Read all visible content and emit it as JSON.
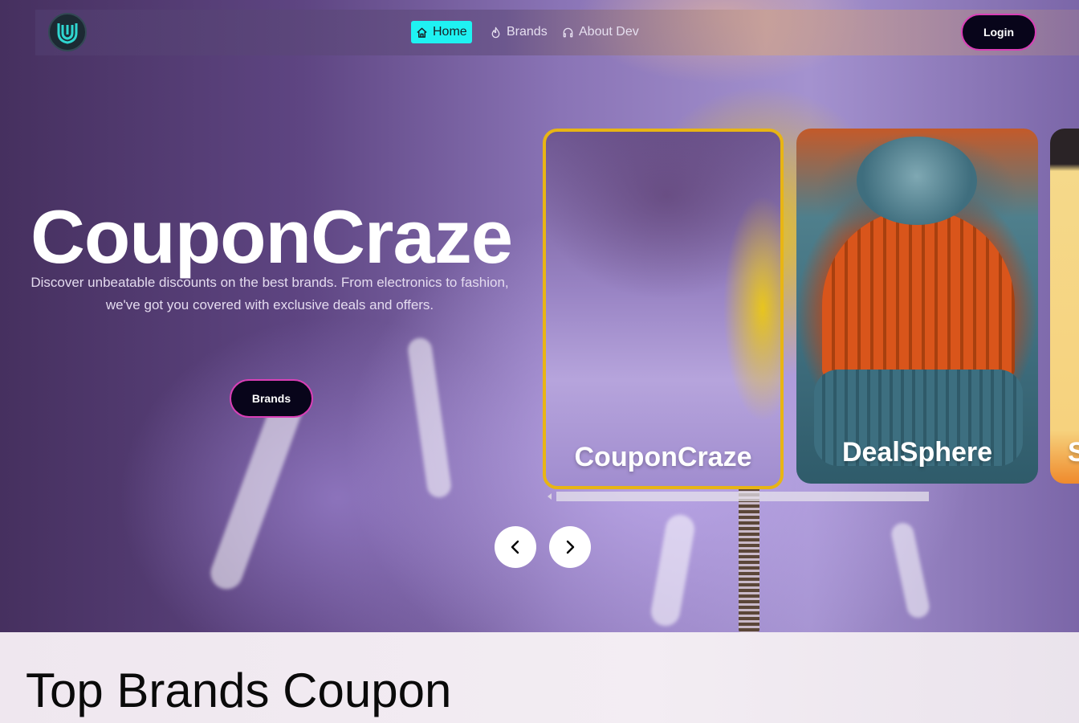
{
  "nav": {
    "links": [
      {
        "label": "Home",
        "icon": "home-icon",
        "active": true
      },
      {
        "label": "Brands",
        "icon": "flame-icon",
        "active": false
      },
      {
        "label": "About Dev",
        "icon": "headphones-icon",
        "active": false
      }
    ],
    "login_label": "Login"
  },
  "hero": {
    "title": "CouponCraze",
    "description": "Discover unbeatable discounts on the best brands. From electronics to fashion, we've got you covered with exclusive deals and offers.",
    "cta_label": "Brands"
  },
  "carousel": {
    "cards": [
      {
        "label": "CouponCraze"
      },
      {
        "label": "DealSphere"
      },
      {
        "label": "S"
      }
    ]
  },
  "section": {
    "title": "Top Brands Coupon"
  },
  "colors": {
    "active_nav": "#1ff2f2",
    "button_bg": "#08051a",
    "button_border": "#d93fb6",
    "card_highlight": "#e8b514"
  }
}
